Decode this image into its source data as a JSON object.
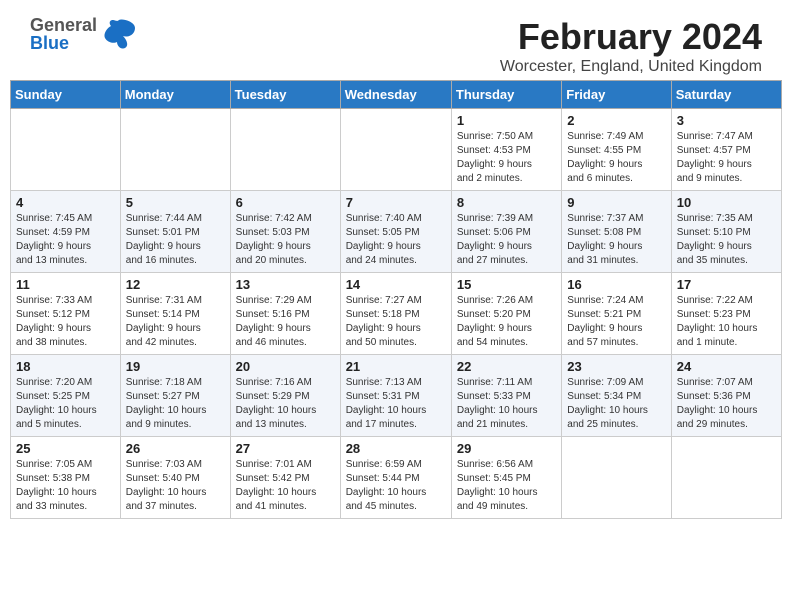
{
  "header": {
    "logo_general": "General",
    "logo_blue": "Blue",
    "main_title": "February 2024",
    "subtitle": "Worcester, England, United Kingdom"
  },
  "weekdays": [
    "Sunday",
    "Monday",
    "Tuesday",
    "Wednesday",
    "Thursday",
    "Friday",
    "Saturday"
  ],
  "weeks": [
    [
      {
        "day": "",
        "detail": ""
      },
      {
        "day": "",
        "detail": ""
      },
      {
        "day": "",
        "detail": ""
      },
      {
        "day": "",
        "detail": ""
      },
      {
        "day": "1",
        "detail": "Sunrise: 7:50 AM\nSunset: 4:53 PM\nDaylight: 9 hours\nand 2 minutes."
      },
      {
        "day": "2",
        "detail": "Sunrise: 7:49 AM\nSunset: 4:55 PM\nDaylight: 9 hours\nand 6 minutes."
      },
      {
        "day": "3",
        "detail": "Sunrise: 7:47 AM\nSunset: 4:57 PM\nDaylight: 9 hours\nand 9 minutes."
      }
    ],
    [
      {
        "day": "4",
        "detail": "Sunrise: 7:45 AM\nSunset: 4:59 PM\nDaylight: 9 hours\nand 13 minutes."
      },
      {
        "day": "5",
        "detail": "Sunrise: 7:44 AM\nSunset: 5:01 PM\nDaylight: 9 hours\nand 16 minutes."
      },
      {
        "day": "6",
        "detail": "Sunrise: 7:42 AM\nSunset: 5:03 PM\nDaylight: 9 hours\nand 20 minutes."
      },
      {
        "day": "7",
        "detail": "Sunrise: 7:40 AM\nSunset: 5:05 PM\nDaylight: 9 hours\nand 24 minutes."
      },
      {
        "day": "8",
        "detail": "Sunrise: 7:39 AM\nSunset: 5:06 PM\nDaylight: 9 hours\nand 27 minutes."
      },
      {
        "day": "9",
        "detail": "Sunrise: 7:37 AM\nSunset: 5:08 PM\nDaylight: 9 hours\nand 31 minutes."
      },
      {
        "day": "10",
        "detail": "Sunrise: 7:35 AM\nSunset: 5:10 PM\nDaylight: 9 hours\nand 35 minutes."
      }
    ],
    [
      {
        "day": "11",
        "detail": "Sunrise: 7:33 AM\nSunset: 5:12 PM\nDaylight: 9 hours\nand 38 minutes."
      },
      {
        "day": "12",
        "detail": "Sunrise: 7:31 AM\nSunset: 5:14 PM\nDaylight: 9 hours\nand 42 minutes."
      },
      {
        "day": "13",
        "detail": "Sunrise: 7:29 AM\nSunset: 5:16 PM\nDaylight: 9 hours\nand 46 minutes."
      },
      {
        "day": "14",
        "detail": "Sunrise: 7:27 AM\nSunset: 5:18 PM\nDaylight: 9 hours\nand 50 minutes."
      },
      {
        "day": "15",
        "detail": "Sunrise: 7:26 AM\nSunset: 5:20 PM\nDaylight: 9 hours\nand 54 minutes."
      },
      {
        "day": "16",
        "detail": "Sunrise: 7:24 AM\nSunset: 5:21 PM\nDaylight: 9 hours\nand 57 minutes."
      },
      {
        "day": "17",
        "detail": "Sunrise: 7:22 AM\nSunset: 5:23 PM\nDaylight: 10 hours\nand 1 minute."
      }
    ],
    [
      {
        "day": "18",
        "detail": "Sunrise: 7:20 AM\nSunset: 5:25 PM\nDaylight: 10 hours\nand 5 minutes."
      },
      {
        "day": "19",
        "detail": "Sunrise: 7:18 AM\nSunset: 5:27 PM\nDaylight: 10 hours\nand 9 minutes."
      },
      {
        "day": "20",
        "detail": "Sunrise: 7:16 AM\nSunset: 5:29 PM\nDaylight: 10 hours\nand 13 minutes."
      },
      {
        "day": "21",
        "detail": "Sunrise: 7:13 AM\nSunset: 5:31 PM\nDaylight: 10 hours\nand 17 minutes."
      },
      {
        "day": "22",
        "detail": "Sunrise: 7:11 AM\nSunset: 5:33 PM\nDaylight: 10 hours\nand 21 minutes."
      },
      {
        "day": "23",
        "detail": "Sunrise: 7:09 AM\nSunset: 5:34 PM\nDaylight: 10 hours\nand 25 minutes."
      },
      {
        "day": "24",
        "detail": "Sunrise: 7:07 AM\nSunset: 5:36 PM\nDaylight: 10 hours\nand 29 minutes."
      }
    ],
    [
      {
        "day": "25",
        "detail": "Sunrise: 7:05 AM\nSunset: 5:38 PM\nDaylight: 10 hours\nand 33 minutes."
      },
      {
        "day": "26",
        "detail": "Sunrise: 7:03 AM\nSunset: 5:40 PM\nDaylight: 10 hours\nand 37 minutes."
      },
      {
        "day": "27",
        "detail": "Sunrise: 7:01 AM\nSunset: 5:42 PM\nDaylight: 10 hours\nand 41 minutes."
      },
      {
        "day": "28",
        "detail": "Sunrise: 6:59 AM\nSunset: 5:44 PM\nDaylight: 10 hours\nand 45 minutes."
      },
      {
        "day": "29",
        "detail": "Sunrise: 6:56 AM\nSunset: 5:45 PM\nDaylight: 10 hours\nand 49 minutes."
      },
      {
        "day": "",
        "detail": ""
      },
      {
        "day": "",
        "detail": ""
      }
    ]
  ]
}
